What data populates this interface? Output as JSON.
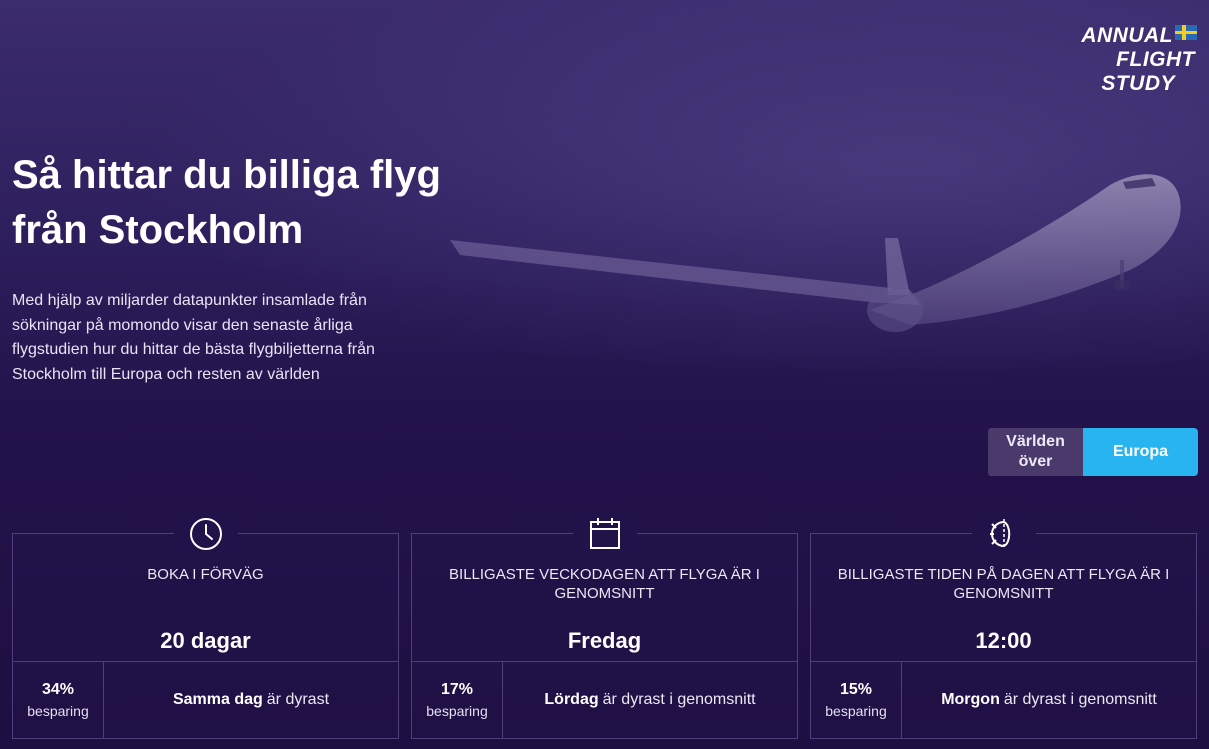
{
  "logo": {
    "line1": "ANNUAL",
    "line2": "FLIGHT",
    "line3": "STUDY",
    "flag_icon": "sweden-flag"
  },
  "hero": {
    "headline_line1": "Så hittar du billiga flyg",
    "headline_line2": "från Stockholm",
    "intro": "Med hjälp av miljarder datapunkter insamlade från sökningar på momondo visar den senaste årliga flygstudien hur du hittar de bästa flygbiljetterna från Stockholm till Europa och resten av världen"
  },
  "region_toggle": {
    "options": [
      {
        "label": "Världen över",
        "selected": false
      },
      {
        "label": "Europa",
        "selected": true
      }
    ],
    "accent": "#27b4f0"
  },
  "cards": [
    {
      "icon": "clock-icon",
      "title": "BOKA I FÖRVÄG",
      "value": "20 dagar",
      "saving_pct": "34%",
      "saving_label": "besparing",
      "note_bold": "Samma dag",
      "note_rest": "är dyrast"
    },
    {
      "icon": "calendar-icon",
      "title": "BILLIGASTE VECKODAGEN ATT FLYGA ÄR I GENOMSNITT",
      "value": "Fredag",
      "saving_pct": "17%",
      "saving_label": "besparing",
      "note_bold": "Lördag",
      "note_rest": "är dyrast i genomsnitt"
    },
    {
      "icon": "day-night-icon",
      "title": "BILLIGASTE TIDEN PÅ DAGEN ATT FLYGA ÄR I GENOMSNITT",
      "value": "12:00",
      "saving_pct": "15%",
      "saving_label": "besparing",
      "note_bold": "Morgon",
      "note_rest": "är dyrast i genomsnitt"
    }
  ]
}
